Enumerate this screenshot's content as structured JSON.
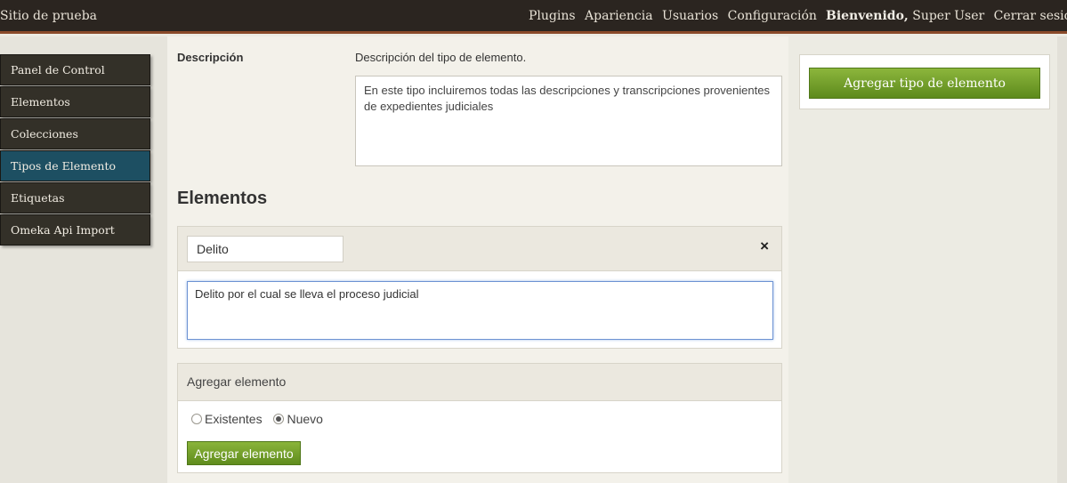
{
  "header": {
    "site_title": "Sitio de prueba",
    "nav": [
      "Plugins",
      "Apariencia",
      "Usuarios",
      "Configuración"
    ],
    "welcome": "Bienvenido,",
    "user": "Super User",
    "logout": "Cerrar sesión"
  },
  "sidebar": {
    "items": [
      {
        "label": "Panel de Control"
      },
      {
        "label": "Elementos"
      },
      {
        "label": "Colecciones"
      },
      {
        "label": "Tipos de Elemento"
      },
      {
        "label": "Etiquetas"
      },
      {
        "label": "Omeka Api Import"
      }
    ],
    "active": "Tipos de Elemento"
  },
  "form": {
    "description_label": "Descripción",
    "description_hint": "Descripción del tipo de elemento.",
    "description_value": "En este tipo incluiremos todas las descripciones y transcripciones provenientes de expedientes judiciales",
    "elements_heading": "Elementos",
    "element": {
      "name": "Delito",
      "remove_icon": "×",
      "description": "Delito por el cual se lleva el proceso judicial"
    },
    "add_element": {
      "title": "Agregar elemento",
      "option_existing": "Existentes",
      "option_new": "Nuevo",
      "selected": "Nuevo",
      "button": "Agregar elemento"
    }
  },
  "actions": {
    "add_type_button": "Agregar tipo de elemento"
  },
  "colors": {
    "topbar": "#2b2520",
    "accent_border": "#8a4a2a",
    "nav_active": "#1d4f62",
    "button_green": "#6f9e28"
  }
}
